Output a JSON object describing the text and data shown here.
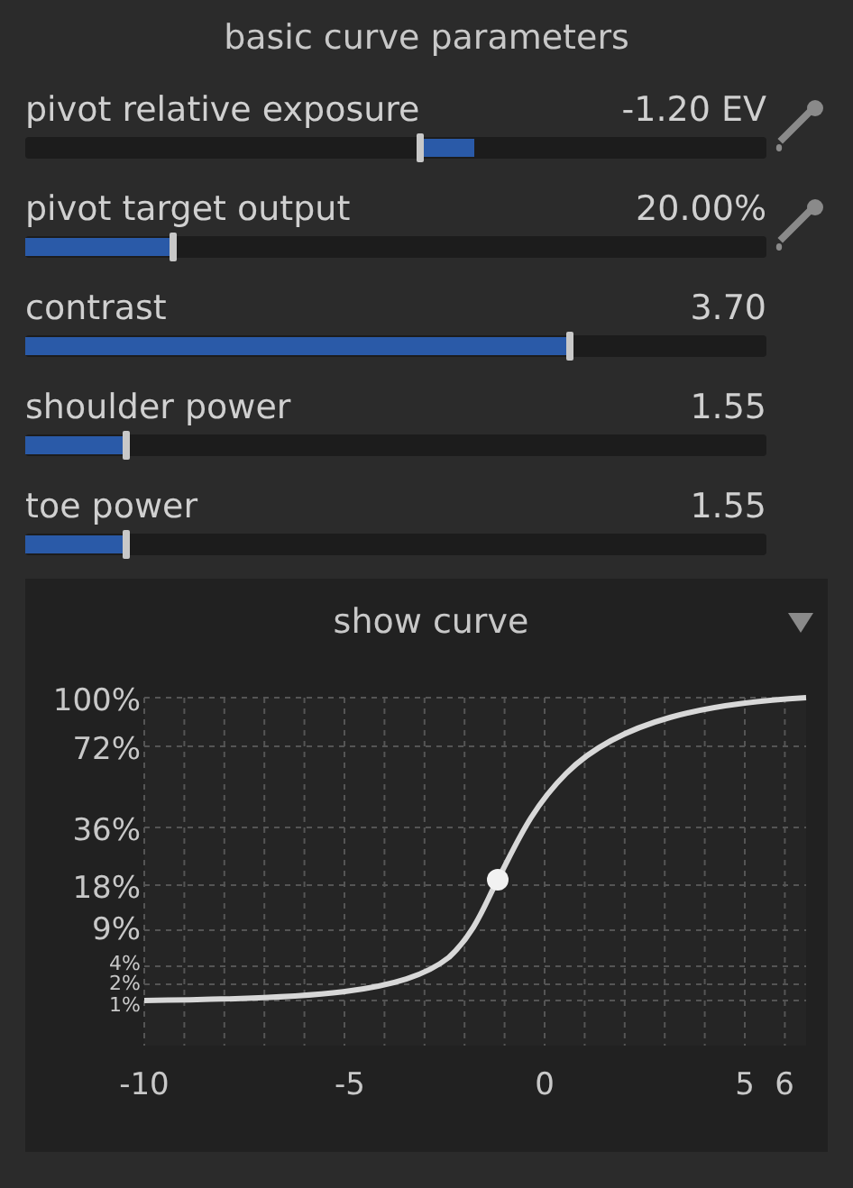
{
  "section_title": "basic curve parameters",
  "sliders": [
    {
      "label": "pivot relative exposure",
      "value": "-1.20 EV",
      "level": 0.533,
      "kind": "bipolar",
      "picker": true
    },
    {
      "label": "pivot target output",
      "value": "20.00%",
      "level": 0.2,
      "kind": "plain",
      "picker": true
    },
    {
      "label": "contrast",
      "value": "3.70",
      "level": 0.735,
      "kind": "plain",
      "picker": false
    },
    {
      "label": "shoulder power",
      "value": "1.55",
      "level": 0.136,
      "kind": "plain",
      "picker": false
    },
    {
      "label": "toe power",
      "value": "1.55",
      "level": 0.136,
      "kind": "plain",
      "picker": false
    }
  ],
  "curve_panel": {
    "title": "show curve",
    "expanded": true,
    "y_labels": [
      "100%",
      "72%",
      "36%",
      "18%",
      "9%",
      "4%",
      "2%",
      "1%"
    ],
    "x_labels": [
      "-10",
      "-5",
      "0",
      "5",
      "6"
    ]
  }
}
